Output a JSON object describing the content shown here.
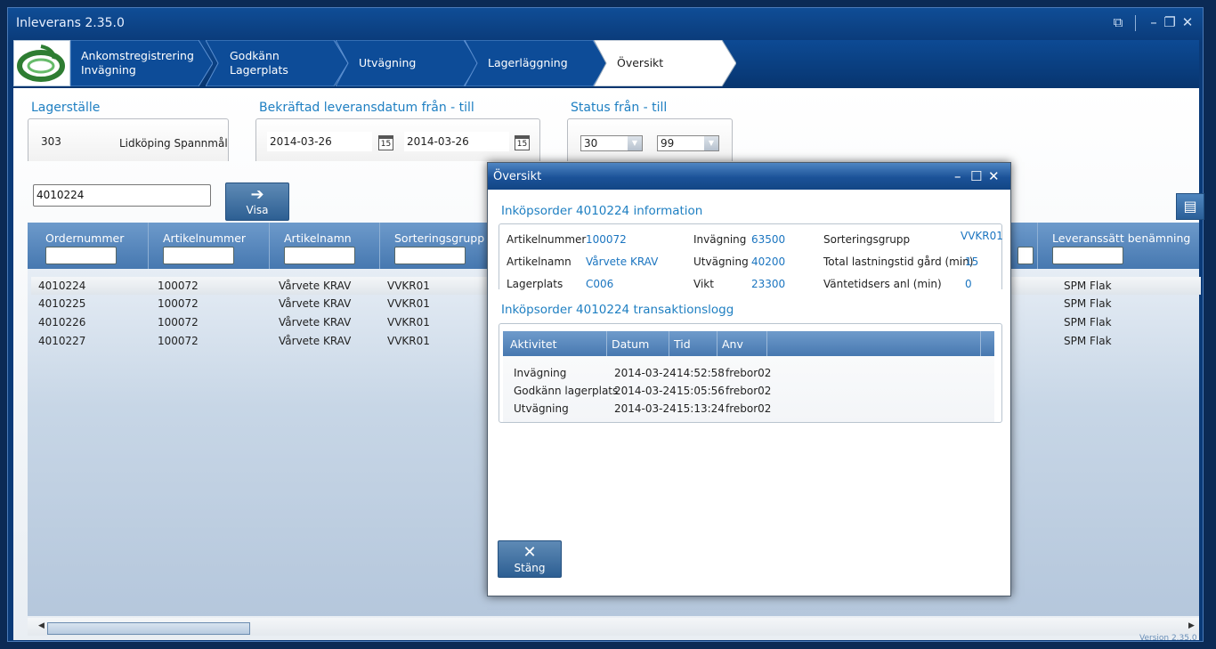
{
  "window": {
    "title": "Inleverans 2.35.0",
    "version": "Version 2.35.0"
  },
  "breadcrumbs": [
    {
      "line1": "Ankomstregistrering",
      "line2": "Invägning"
    },
    {
      "line1": "Godkänn",
      "line2": "Lagerplats"
    },
    {
      "line1": "Utvägning",
      "line2": ""
    },
    {
      "line1": "Lagerläggning",
      "line2": ""
    },
    {
      "line1": "Översikt",
      "line2": ""
    }
  ],
  "filters": {
    "lagerstalle_label": "Lagerställe",
    "lagerstalle_code": "303",
    "lagerstalle_name": "Lidköping Spannmål",
    "date_label": "Bekräftad leveransdatum från - till",
    "date_from": "2014-03-26",
    "date_to": "2014-03-26",
    "calendar_day": "15",
    "status_label": "Status från - till",
    "status_from": "30",
    "status_to": "99"
  },
  "search": {
    "value": "4010224",
    "button_label": "Visa"
  },
  "grid": {
    "columns": [
      "Ordernummer",
      "Artikelnummer",
      "Artikelnamn",
      "Sorteringsgrupp",
      "Leveranssätt benämning"
    ],
    "rows": [
      [
        "4010224",
        "100072",
        "Vårvete KRAV",
        "VVKR01",
        "SPM Flak"
      ],
      [
        "4010225",
        "100072",
        "Vårvete KRAV",
        "VVKR01",
        "SPM Flak"
      ],
      [
        "4010226",
        "100072",
        "Vårvete KRAV",
        "VVKR01",
        "SPM Flak"
      ],
      [
        "4010227",
        "100072",
        "Vårvete KRAV",
        "VVKR01",
        "SPM Flak"
      ]
    ]
  },
  "modal": {
    "title": "Översikt",
    "info_title": "Inköpsorder 4010224 information",
    "info": {
      "artikelnummer_k": "Artikelnummer",
      "artikelnummer_v": "100072",
      "artikelnamn_k": "Artikelnamn",
      "artikelnamn_v": "Vårvete KRAV",
      "lagerplats_k": "Lagerplats",
      "lagerplats_v": "C006",
      "invagning_k": "Invägning",
      "invagning_v": "63500",
      "utvagning_k": "Utvägning",
      "utvagning_v": "40200",
      "vikt_k": "Vikt",
      "vikt_v": "23300",
      "sortering_k": "Sorteringsgrupp",
      "sortering_v": "VVKR01",
      "lastning_k": "Total lastningstid gård (min)",
      "lastning_v": "15",
      "vantetid_k": "Väntetidsers anl (min)",
      "vantetid_v": "0"
    },
    "log_title": "Inköpsorder 4010224 transaktionslogg",
    "log_columns": [
      "Aktivitet",
      "Datum",
      "Tid",
      "Anv"
    ],
    "log_rows": [
      [
        "Invägning",
        "2014-03-24",
        "14:52:58",
        "frebor02"
      ],
      [
        "Godkänn lagerplats",
        "2014-03-24",
        "15:05:56",
        "frebor02"
      ],
      [
        "Utvägning",
        "2014-03-24",
        "15:13:24",
        "frebor02"
      ]
    ],
    "close_label": "Stäng"
  },
  "colors": {
    "accent": "#1e7fc2",
    "header": "#0f4d96",
    "grid_header": "#5a89bf"
  },
  "icons": [
    "restore-icon",
    "minimize-icon",
    "maximize-icon",
    "close-icon",
    "calendar-icon",
    "arrow-right-icon",
    "layout-icon"
  ]
}
